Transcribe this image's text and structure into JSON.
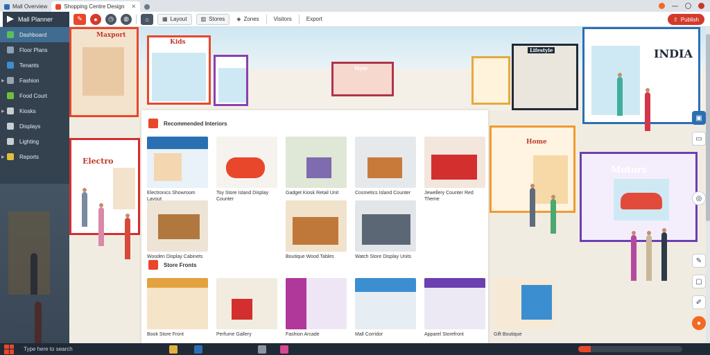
{
  "browser": {
    "tabs": [
      {
        "label": "Mall Overview",
        "icon": "map-icon",
        "active": false
      },
      {
        "label": "Shopping Centre Design",
        "icon": "shop-icon",
        "active": true
      },
      {
        "label": "",
        "icon": "chat-icon",
        "active": false
      }
    ]
  },
  "toolbar": {
    "app_title": "Mall Planner",
    "buttons": [
      {
        "label": "Layout",
        "icon": "grid-icon"
      },
      {
        "label": "Stores",
        "icon": "store-icon"
      },
      {
        "label": "Zones",
        "icon": "layers-icon"
      },
      {
        "label": "Visitors",
        "icon": "people-icon"
      },
      {
        "label": "Export",
        "icon": "export-icon"
      }
    ],
    "action_label": "Publish"
  },
  "sidebar": {
    "items": [
      {
        "label": "Dashboard",
        "icon": "dashboard-icon"
      },
      {
        "label": "Floor Plans",
        "icon": "floorplan-icon"
      },
      {
        "label": "Tenants",
        "icon": "tenant-icon"
      },
      {
        "label": "Fashion",
        "icon": "fashion-icon"
      },
      {
        "label": "Food Court",
        "icon": "food-icon"
      },
      {
        "label": "Kiosks",
        "icon": "kiosk-icon"
      },
      {
        "label": "Displays",
        "icon": "display-icon"
      },
      {
        "label": "Lighting",
        "icon": "light-icon"
      },
      {
        "label": "Reports",
        "icon": "report-icon"
      }
    ]
  },
  "scene": {
    "signs": {
      "left_store": "Maxport",
      "left_lower_store": "Electro",
      "right_upper_store": "INDIA",
      "right_mid_store": "Home",
      "right_lower_store": "Motors",
      "center_store_1": "Kids",
      "center_store_2": "Style",
      "right_store_2": "Lifestyle"
    }
  },
  "panel": {
    "section1_title": "Recommended Interiors",
    "section2_title": "Store Fronts",
    "cards1": [
      {
        "caption": "Electronics Showroom Layout"
      },
      {
        "caption": "Toy Store Island Display Counter"
      },
      {
        "caption": "Gadget Kiosk Retail Unit"
      },
      {
        "caption": "Cosmetics Island Counter"
      },
      {
        "caption": "Jewellery Counter Red Theme"
      },
      {
        "caption": "Wooden Display Cabinets"
      },
      {
        "caption": ""
      },
      {
        "caption": "Boutique Wood Tables"
      },
      {
        "caption": "Watch Store Display Units"
      },
      {
        "caption": ""
      }
    ],
    "cards2": [
      {
        "caption": "Book Store Front"
      },
      {
        "caption": "Perfume Gallery"
      },
      {
        "caption": "Fashion Arcade"
      },
      {
        "caption": "Mall Corridor"
      },
      {
        "caption": "Apparel Storefront"
      },
      {
        "caption": "Gift Boutique"
      }
    ]
  },
  "taskbar": {
    "search_text": "Type here to search",
    "progress": 0.12
  },
  "colors": {
    "accent": "#e8472c",
    "sidebar": "#34414f",
    "active": "#3f6c90"
  }
}
